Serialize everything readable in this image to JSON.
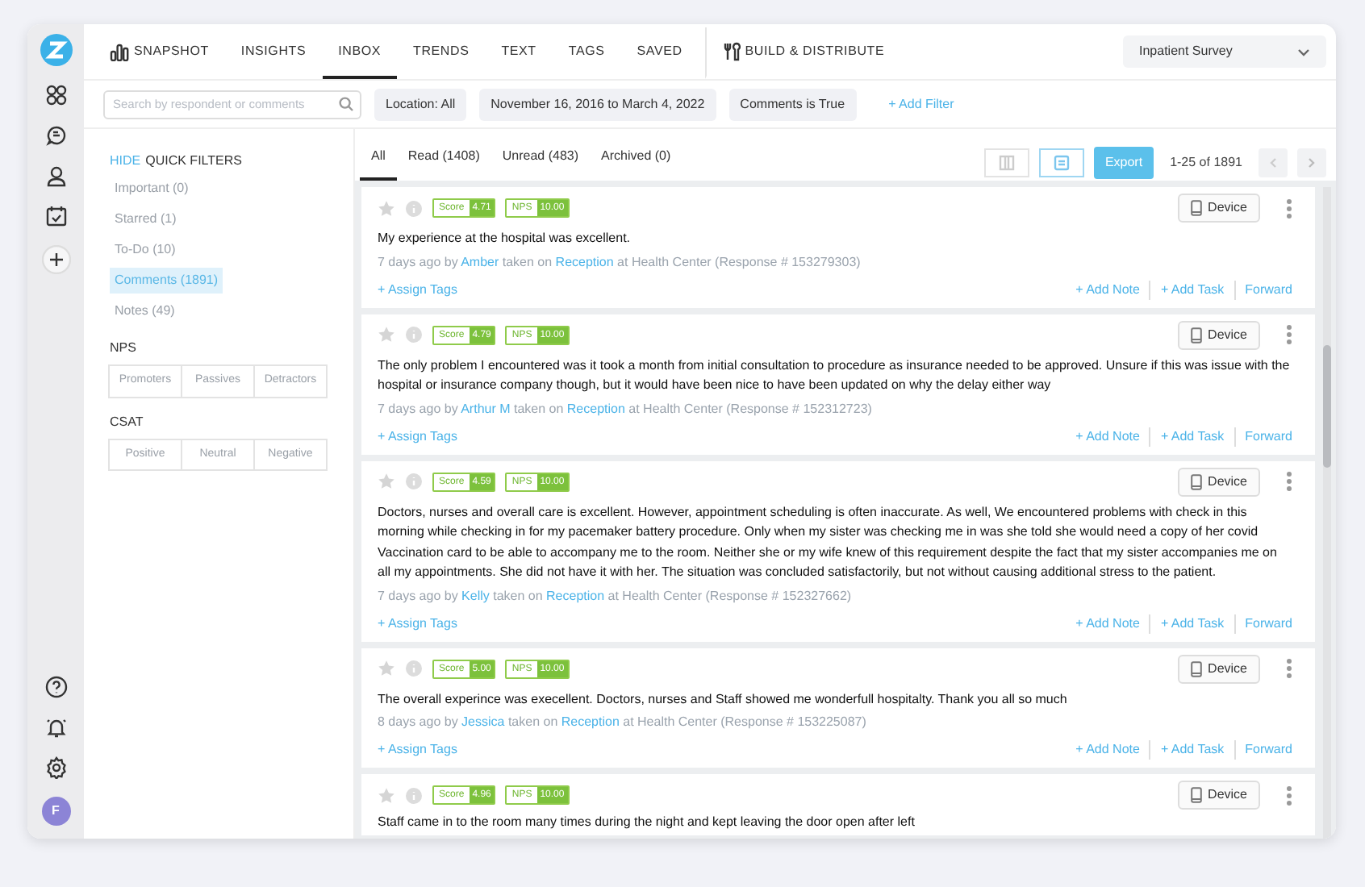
{
  "nav": {
    "items": [
      {
        "label": "SNAPSHOT",
        "selected": false,
        "kind": "chart"
      },
      {
        "label": "INSIGHTS",
        "selected": false,
        "kind": "plain"
      },
      {
        "label": "INBOX",
        "selected": true,
        "kind": "plain"
      },
      {
        "label": "TRENDS",
        "selected": false,
        "kind": "plain"
      },
      {
        "label": "TEXT",
        "selected": false,
        "kind": "plain"
      },
      {
        "label": "TAGS",
        "selected": false,
        "kind": "plain"
      },
      {
        "label": "SAVED",
        "selected": false,
        "kind": "plain"
      },
      {
        "label": "BUILD & DISTRIBUTE",
        "selected": false,
        "kind": "tools"
      }
    ],
    "survey": "Inpatient Survey"
  },
  "filter_bar": {
    "search_placeholder": "Search by respondent or comments",
    "chips": [
      "Location: All",
      "November 16, 2016 to March 4, 2022",
      "Comments is True"
    ],
    "add_filter": "+ Add Filter"
  },
  "rail": {
    "avatar": "F"
  },
  "quick_filters": {
    "hide": "HIDE",
    "title": "QUICK FILTERS",
    "items": [
      {
        "label": "Important (0)",
        "selected": false
      },
      {
        "label": "Starred (1)",
        "selected": false
      },
      {
        "label": "To-Do (10)",
        "selected": false
      },
      {
        "label": "Comments (1891)",
        "selected": true
      },
      {
        "label": "Notes (49)",
        "selected": false
      }
    ],
    "groups": [
      {
        "title": "NPS",
        "options": [
          "Promoters",
          "Passives",
          "Detractors"
        ]
      },
      {
        "title": "CSAT",
        "options": [
          "Positive",
          "Neutral",
          "Negative"
        ]
      }
    ]
  },
  "inbox_tabs": [
    {
      "label": "All",
      "selected": true
    },
    {
      "label": "Read (1408)",
      "selected": false
    },
    {
      "label": "Unread (483)",
      "selected": false
    },
    {
      "label": "Archived (0)",
      "selected": false
    }
  ],
  "views": [
    {
      "kind": "columns",
      "selected": false
    },
    {
      "kind": "list",
      "selected": true
    }
  ],
  "export": "Export",
  "pagination": "1-25 of 1891",
  "responses": [
    {
      "starred": false,
      "score_label": "Score",
      "score": "4.71",
      "nps_label": "NPS",
      "nps": "10.00",
      "device": "Device",
      "comment": "My experience at the hospital was excellent.",
      "age": "7 days ago by",
      "respondent": "Amber",
      "taken": "taken on",
      "location": "Reception",
      "detail": "at Health Center (Response # 153279303)",
      "assign": "+ Assign Tags",
      "actions": [
        "+ Add Note",
        "+ Add Task",
        "Forward"
      ]
    },
    {
      "starred": false,
      "score_label": "Score",
      "score": "4.79",
      "nps_label": "NPS",
      "nps": "10.00",
      "device": "Device",
      "comment": "The only problem I encountered was it took a month from initial consultation to procedure as insurance needed to be approved. Unsure if this was issue with the hospital or insurance company though, but it would have been nice to have been updated on why the delay either way",
      "age": "7 days ago by",
      "respondent": "Arthur M",
      "taken": "taken on",
      "location": "Reception",
      "detail": "at Health Center (Response # 152312723)",
      "assign": "+ Assign Tags",
      "actions": [
        "+ Add Note",
        "+ Add Task",
        "Forward"
      ]
    },
    {
      "starred": false,
      "score_label": "Score",
      "score": "4.59",
      "nps_label": "NPS",
      "nps": "10.00",
      "device": "Device",
      "comment": "Doctors, nurses and overall care is excellent. However, appointment scheduling is often inaccurate. As well, We encountered problems with check in this morning while checking in for my pacemaker battery procedure. Only when my sister was checking me in was she told she would need a copy of her covid Vaccination card to be able to accompany me to the room. Neither she or my wife knew of this requirement despite the fact that my sister accompanies me on all my appointments. She did not have it with her. The situation was concluded satisfactorily, but not without causing additional stress to the patient.",
      "age": "7 days ago by",
      "respondent": "Kelly",
      "taken": "taken on",
      "location": "Reception",
      "detail": "at Health Center (Response # 152327662)",
      "assign": "+ Assign Tags",
      "actions": [
        "+ Add Note",
        "+ Add Task",
        "Forward"
      ]
    },
    {
      "starred": false,
      "score_label": "Score",
      "score": "5.00",
      "nps_label": "NPS",
      "nps": "10.00",
      "device": "Device",
      "comment": "The overall experince was execellent. Doctors, nurses and Staff showed me wonderfull hospitalty. Thank you all so much",
      "age": "8 days ago by",
      "respondent": "Jessica",
      "taken": "taken on",
      "location": "Reception",
      "detail": "at Health Center (Response # 153225087)",
      "assign": "+ Assign Tags",
      "actions": [
        "+ Add Note",
        "+ Add Task",
        "Forward"
      ]
    },
    {
      "starred": false,
      "score_label": "Score",
      "score": "4.96",
      "nps_label": "NPS",
      "nps": "10.00",
      "device": "Device",
      "comment": "Staff came in to the room many times during the night and kept leaving the door open after left"
    }
  ]
}
